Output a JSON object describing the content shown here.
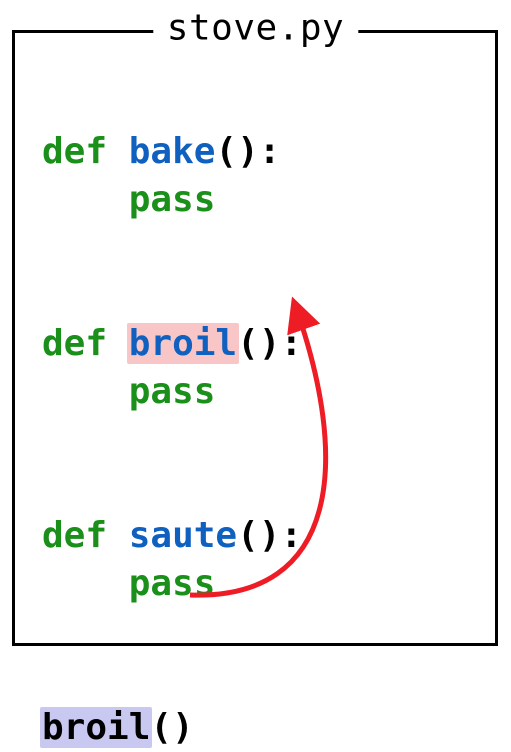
{
  "filename": "stove.py",
  "code": {
    "keyword_def": "def",
    "keyword_pass": "pass",
    "functions": {
      "bake": "bake",
      "broil": "broil",
      "saute": "saute"
    },
    "call_target": "broil",
    "parens": "()",
    "colon": ":"
  },
  "highlights": {
    "definition": {
      "target": "broil",
      "color": "#f8c6c6"
    },
    "call": {
      "target": "broil",
      "color": "#c8c8f0"
    }
  },
  "arrow": {
    "from": "call-broil",
    "to": "def-broil",
    "color": "#ee1c25"
  }
}
